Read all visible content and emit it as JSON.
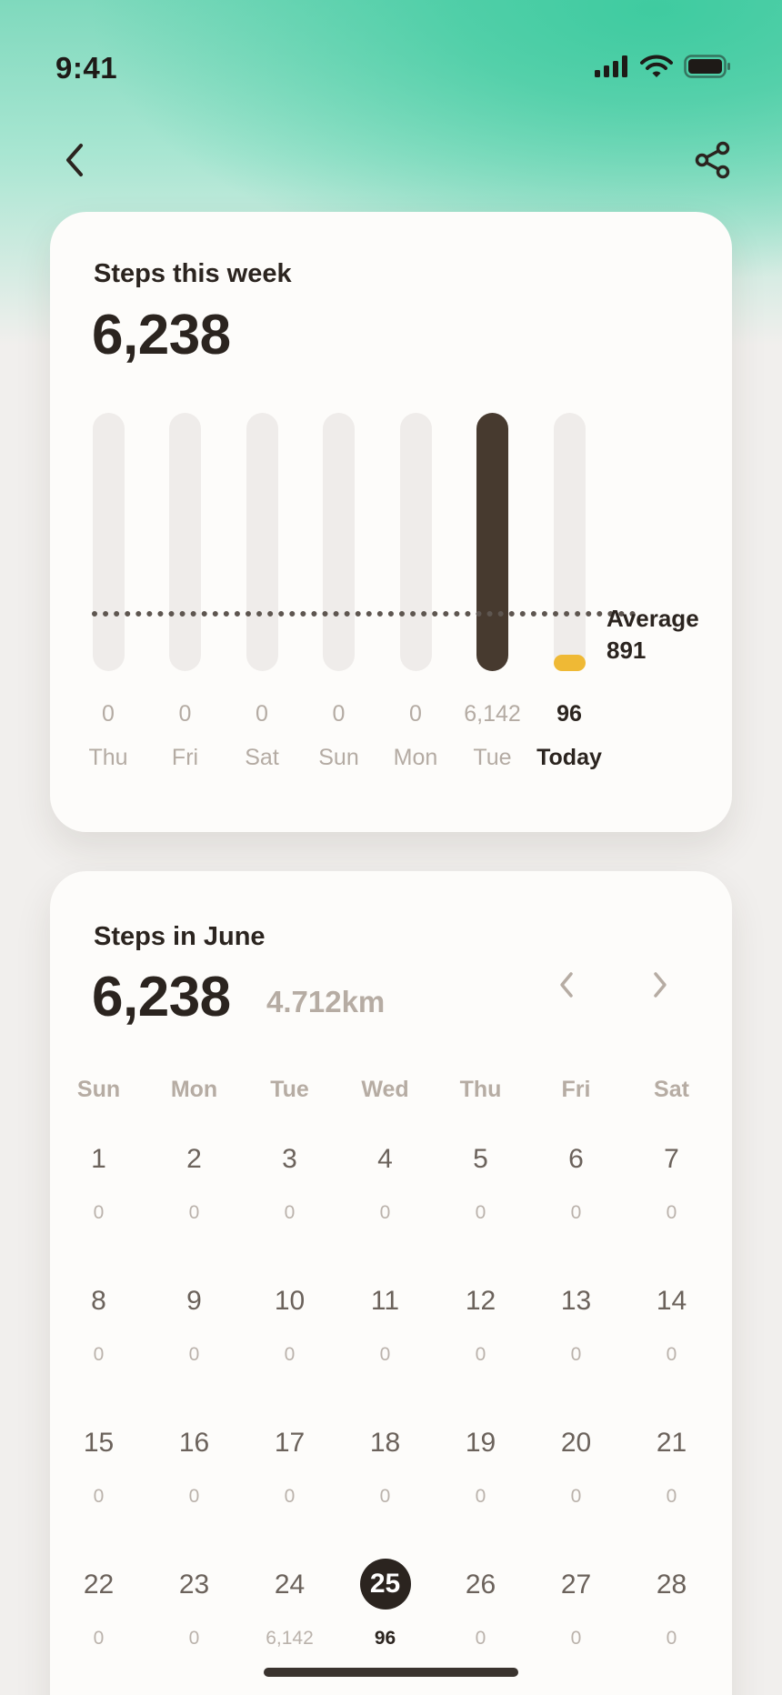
{
  "status_bar": {
    "time": "9:41",
    "icons": [
      "cellular-signal-icon",
      "wifi-icon",
      "battery-icon"
    ]
  },
  "nav": {
    "back_icon": "chevron-left-icon",
    "share_icon": "share-icon"
  },
  "week_card": {
    "title": "Steps this week",
    "total": "6,238",
    "average_label": "Average",
    "average_value": "891",
    "chart_data": {
      "type": "bar",
      "categories": [
        "Thu",
        "Fri",
        "Sat",
        "Sun",
        "Mon",
        "Tue",
        "Today"
      ],
      "values": [
        0,
        0,
        0,
        0,
        0,
        6142,
        96
      ],
      "value_labels": [
        "0",
        "0",
        "0",
        "0",
        "0",
        "6,142",
        "96"
      ],
      "average": 891,
      "highlight_index": 6,
      "colors": {
        "bar": "#473a2f",
        "today": "#efb935",
        "track": "#efecea",
        "average_line": "#5e5650"
      }
    }
  },
  "month_card": {
    "title": "Steps in June",
    "total": "6,238",
    "distance": "4.712km",
    "prev_icon": "chevron-left-icon",
    "next_icon": "chevron-right-icon",
    "weekdays": [
      "Sun",
      "Mon",
      "Tue",
      "Wed",
      "Thu",
      "Fri",
      "Sat"
    ],
    "weeks": [
      [
        {
          "day": "1",
          "steps": "0"
        },
        {
          "day": "2",
          "steps": "0"
        },
        {
          "day": "3",
          "steps": "0"
        },
        {
          "day": "4",
          "steps": "0"
        },
        {
          "day": "5",
          "steps": "0"
        },
        {
          "day": "6",
          "steps": "0"
        },
        {
          "day": "7",
          "steps": "0"
        }
      ],
      [
        {
          "day": "8",
          "steps": "0"
        },
        {
          "day": "9",
          "steps": "0"
        },
        {
          "day": "10",
          "steps": "0"
        },
        {
          "day": "11",
          "steps": "0"
        },
        {
          "day": "12",
          "steps": "0"
        },
        {
          "day": "13",
          "steps": "0"
        },
        {
          "day": "14",
          "steps": "0"
        }
      ],
      [
        {
          "day": "15",
          "steps": "0"
        },
        {
          "day": "16",
          "steps": "0"
        },
        {
          "day": "17",
          "steps": "0"
        },
        {
          "day": "18",
          "steps": "0"
        },
        {
          "day": "19",
          "steps": "0"
        },
        {
          "day": "20",
          "steps": "0"
        },
        {
          "day": "21",
          "steps": "0"
        }
      ],
      [
        {
          "day": "22",
          "steps": "0"
        },
        {
          "day": "23",
          "steps": "0"
        },
        {
          "day": "24",
          "steps": "6,142"
        },
        {
          "day": "25",
          "steps": "96",
          "today": true
        },
        {
          "day": "26",
          "steps": "0"
        },
        {
          "day": "27",
          "steps": "0"
        },
        {
          "day": "28",
          "steps": "0"
        }
      ]
    ]
  }
}
